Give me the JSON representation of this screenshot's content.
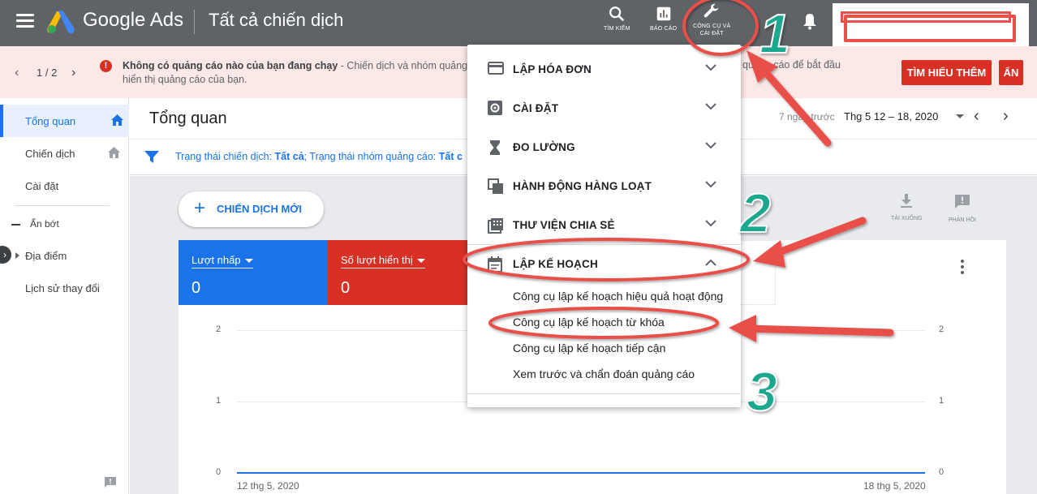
{
  "topbar": {
    "brand": "Google Ads",
    "page_title": "Tất cả chiến dịch",
    "tools": [
      {
        "label": "TÌM KIẾM",
        "icon": "search-icon"
      },
      {
        "label": "BÁO CÁO",
        "icon": "reports-icon"
      },
      {
        "label_line1": "CÔNG CỤ VÀ",
        "label_line2": "CÀI ĐẶT",
        "icon": "wrench-icon"
      }
    ]
  },
  "banner": {
    "pager": "1 / 2",
    "message_bold": "Không có quảng cáo nào của bạn đang chạy",
    "message_rest": " - Chiến dịch và nhóm quảng c",
    "message_line2": "hiển thị quảng cáo của bạn.",
    "message_tail": "quảng cáo để bắt đầu",
    "learn_more": "TÌM HIỂU THÊM",
    "hide": "ẨN"
  },
  "sidebar": {
    "items": [
      {
        "label": "Tổng quan",
        "active": true
      },
      {
        "label": "Chiến dịch",
        "active": false
      },
      {
        "label": "Cài đặt",
        "active": false
      }
    ],
    "collapse_label": "Ẩn bớt",
    "items2": [
      {
        "label": "Địa điểm"
      },
      {
        "label": "Lịch sử thay đổi"
      }
    ]
  },
  "main": {
    "title": "Tổng quan",
    "date_range_label": "7 ngày trước",
    "date_range_value": "Thg 5 12 – 18, 2020",
    "filter_prefix1": "Trạng thái chiến dịch: ",
    "filter_value1": "Tất cả",
    "filter_prefix2": "; Trạng thái nhóm quảng cáo: ",
    "filter_value2": "Tất c",
    "new_campaign": "CHIẾN DỊCH MỚI",
    "download_label": "TẢI XUỐNG",
    "feedback_label": "PHẢN HỒI",
    "metrics": [
      {
        "label": "Lượt nhấp",
        "value": "0",
        "color": "#1a73e8"
      },
      {
        "label": "Số lượt hiển thị",
        "value": "0",
        "color": "#d93025"
      }
    ]
  },
  "chart_data": {
    "type": "line",
    "x": [
      "12 thg 5, 2020",
      "18 thg 5, 2020"
    ],
    "series": [
      {
        "name": "Lượt nhấp",
        "values": [
          0,
          0
        ],
        "color": "#1a73e8"
      },
      {
        "name": "Số lượt hiển thị",
        "values": [
          0,
          0
        ],
        "color": "#d93025"
      }
    ],
    "ylim": [
      0,
      2
    ],
    "y_ticks": [
      "2",
      "1",
      "0"
    ],
    "x_tick_labels": [
      "12 thg 5, 2020",
      "18 thg 5, 2020"
    ],
    "grid": true
  },
  "menu": {
    "sections": [
      {
        "label": "LẬP HÓA ĐƠN",
        "icon": "credit-card-icon",
        "expanded": false
      },
      {
        "label": "CÀI ĐẶT",
        "icon": "settings-icon",
        "expanded": false
      },
      {
        "label": "ĐO LƯỜNG",
        "icon": "hourglass-icon",
        "expanded": false
      },
      {
        "label": "HÀNH ĐỘNG HÀNG LOẠT",
        "icon": "copy-icon",
        "expanded": false
      },
      {
        "label": "THƯ VIỆN CHIA SẺ",
        "icon": "library-icon",
        "expanded": false
      },
      {
        "label": "LẬP KẾ HOẠCH",
        "icon": "calendar-icon",
        "expanded": true
      }
    ],
    "planning_items": [
      "Công cụ lập kế hoạch hiệu quả hoạt động",
      "Công cụ lập kế hoạch từ khóa",
      "Công cụ lập kế hoạch tiếp cận",
      "Xem trước và chẩn đoán quảng cáo"
    ]
  },
  "annotations": {
    "step1": "1",
    "step2": "2",
    "step3": "3",
    "arrow_color": "#e8504a",
    "number_color": "#1fa88f"
  }
}
